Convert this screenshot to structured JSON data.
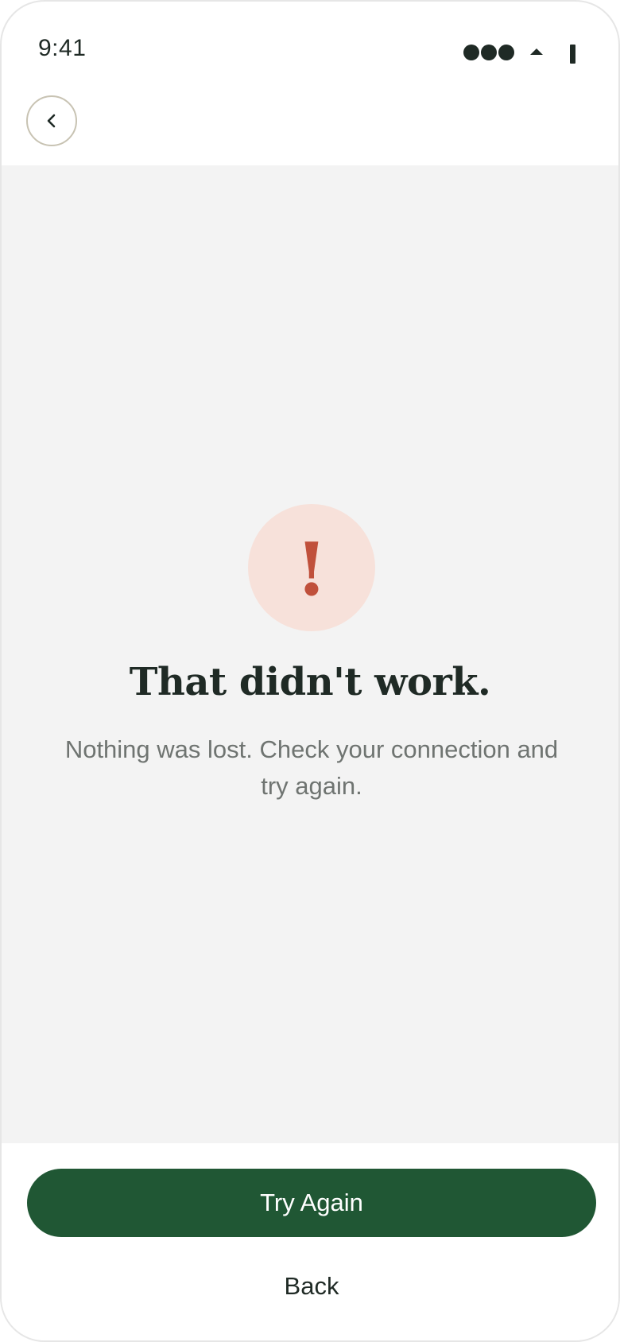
{
  "status_bar": {
    "time": "9:41",
    "icons": [
      "signal-icon",
      "wifi-icon",
      "battery-icon"
    ]
  },
  "header": {
    "back_icon": "chevron-left-icon"
  },
  "error_state": {
    "icon": "exclamation-icon",
    "icon_glyph": "!",
    "title": "That didn't work.",
    "message": "Nothing was lost. Check your connection and try again."
  },
  "footer": {
    "primary_label": "Try Again",
    "secondary_label": "Back"
  },
  "colors": {
    "primary": "#205734",
    "error": "#c0503b",
    "error_bg": "#f7e1da",
    "content_bg": "#f3f3f3",
    "text": "#1f2a25",
    "muted_text": "#6f7471"
  }
}
